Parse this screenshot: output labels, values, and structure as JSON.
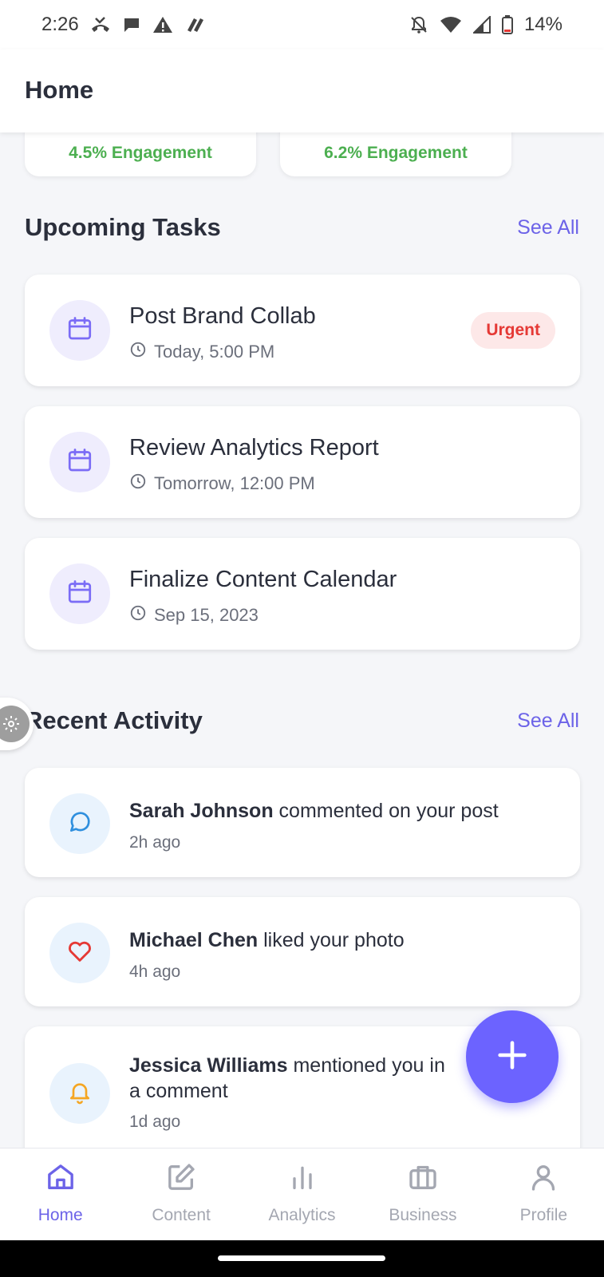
{
  "status_bar": {
    "time": "2:26",
    "battery": "14%"
  },
  "app_bar": {
    "title": "Home"
  },
  "stats": [
    {
      "engagement": "4.5% Engagement"
    },
    {
      "engagement": "6.2% Engagement"
    }
  ],
  "upcoming_tasks": {
    "heading": "Upcoming Tasks",
    "see_all": "See All",
    "items": [
      {
        "title": "Post Brand Collab",
        "time": "Today, 5:00 PM",
        "badge": "Urgent",
        "icon": "calendar-icon"
      },
      {
        "title": "Review Analytics Report",
        "time": "Tomorrow, 12:00 PM",
        "icon": "calendar-icon"
      },
      {
        "title": "Finalize Content Calendar",
        "time": "Sep 15, 2023",
        "icon": "calendar-icon"
      }
    ]
  },
  "recent_activity": {
    "heading": "Recent Activity",
    "see_all": "See All",
    "items": [
      {
        "actor": "Sarah Johnson",
        "action": " commented on your post",
        "time": "2h ago",
        "icon": "comment-icon",
        "icon_color": "#2f8fde"
      },
      {
        "actor": "Michael Chen",
        "action": " liked your photo",
        "time": "4h ago",
        "icon": "heart-icon",
        "icon_color": "#e53935"
      },
      {
        "actor": "Jessica Williams",
        "action": " mentioned you in a comment",
        "time": "1d ago",
        "icon": "bell-icon",
        "icon_color": "#f5a623"
      }
    ]
  },
  "bottom_nav": {
    "items": [
      {
        "label": "Home",
        "icon": "home-icon",
        "active": true
      },
      {
        "label": "Content",
        "icon": "edit-icon",
        "active": false
      },
      {
        "label": "Analytics",
        "icon": "bar-chart-icon",
        "active": false
      },
      {
        "label": "Business",
        "icon": "briefcase-icon",
        "active": false
      },
      {
        "label": "Profile",
        "icon": "user-icon",
        "active": false
      }
    ]
  },
  "colors": {
    "accent": "#6c63ff",
    "urgent": "#e53935",
    "engagement": "#4caf50"
  }
}
